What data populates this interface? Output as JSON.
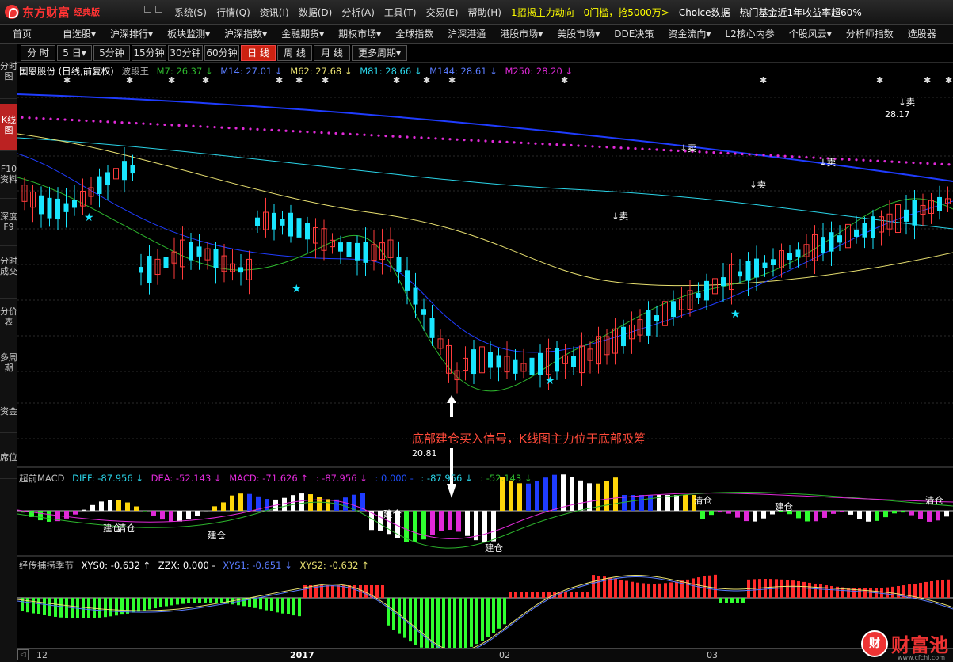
{
  "app": {
    "logo_name": "东方财富",
    "edition": "经典版"
  },
  "menu": [
    "系统(S)",
    "行情(Q)",
    "资讯(I)",
    "数据(D)",
    "分析(A)",
    "工具(T)",
    "交易(E)",
    "帮助(H)"
  ],
  "menu_links": [
    "1招揭主力动向",
    "0门槛，抢5000万>",
    "Choice数据",
    "热门基金近1年收益率超60%"
  ],
  "nav": [
    "首页",
    "自选股▾",
    "沪深排行▾",
    "板块监测▾",
    "沪深指数▾",
    "金融期货▾",
    "期权市场▾",
    "全球指数",
    "沪深港通",
    "港股市场▾",
    "美股市场▾",
    "DDE决策",
    "资金流向▾",
    "L2核心内参",
    "个股风云▾",
    "分析师指数",
    "选股器"
  ],
  "left_tabs": [
    "分时图",
    "K线图",
    "F10资料",
    "深度F9",
    "分时成交",
    "分价表",
    "多周期",
    "资金",
    "席位"
  ],
  "period_tabs": [
    "分 时",
    "5 日▾",
    "5分钟",
    "15分钟",
    "30分钟",
    "60分钟",
    "日 线",
    "周 线",
    "月 线",
    "更多周期▾"
  ],
  "active_period": "日 线",
  "kline": {
    "stock": "国恩股份 (日线,前复权)",
    "indicator": "波段王",
    "mas": [
      {
        "name": "M7: 26.37 ↓",
        "color": "#2db52d"
      },
      {
        "name": "M14: 27.01 ↓",
        "color": "#1f4fff"
      },
      {
        "name": "M62: 27.68 ↓",
        "color": "#e8e070"
      },
      {
        "name": "M81: 28.66 ↓",
        "color": "#2ad4e8"
      },
      {
        "name": "M144: 28.61 ↓",
        "color": "#1f4fff"
      },
      {
        "name": "M250: 28.20 ↓",
        "color": "#e02ad8"
      }
    ],
    "high_label": "28.17",
    "low_label": "20.81",
    "sell_label": "↓卖",
    "annotation": "底部建仓买入信号，K线图主力位于底部吸筹"
  },
  "macd": {
    "title": "超前MACD",
    "items": [
      {
        "text": "DIFF: -87.956 ↓",
        "color": "#2ad4e8"
      },
      {
        "text": "DEA: -52.143 ↓",
        "color": "#e02ad8"
      },
      {
        "text": "MACD: -71.626 ↑",
        "color": "#e02ad8"
      },
      {
        "text": ": -87.956 ↓",
        "color": "#e02ad8"
      },
      {
        "text": ": 0.000 -",
        "color": "#1f4fff"
      },
      {
        "text": ": -87.956 ↓",
        "color": "#2ad4e8"
      },
      {
        "text": ": -52.143 ↓",
        "color": "#2db52d"
      }
    ],
    "labels": [
      "建仓",
      "清仓",
      "建仓",
      "建仓",
      "建仓",
      "清仓",
      "建仓",
      "清仓"
    ]
  },
  "osc": {
    "title": "经传捕捞季节",
    "items": [
      {
        "text": "XYS0: -0.632 ↑",
        "color": "#fff"
      },
      {
        "text": "ZZX: 0.000 -",
        "color": "#fff"
      },
      {
        "text": "XYS1: -0.651 ↓",
        "color": "#1f4fff"
      },
      {
        "text": "XYS2: -0.632 ↑",
        "color": "#e8e070"
      }
    ]
  },
  "xaxis": [
    "12",
    "2017",
    "02",
    "03"
  ],
  "watermark": {
    "badge": "财",
    "name": "财富池",
    "url": "www.cfchi.com"
  }
}
